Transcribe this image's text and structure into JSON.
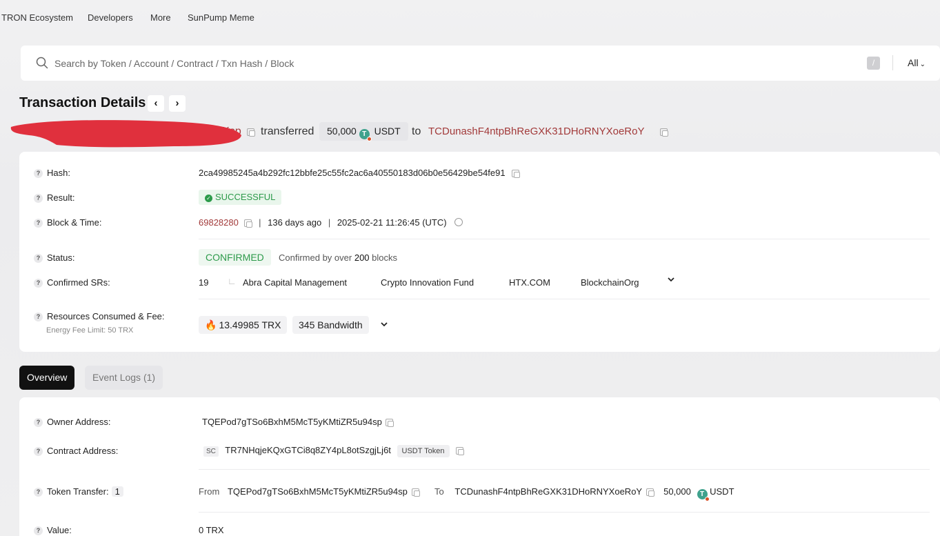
{
  "nav": {
    "items": [
      "TRON Ecosystem",
      "Developers",
      "More",
      "SunPump Meme"
    ]
  },
  "search": {
    "placeholder": "Search by Token / Account / Contract / Txn Hash / Block",
    "shortcut": "/",
    "filter": "All"
  },
  "page": {
    "title": "Transaction Details",
    "prev": "‹",
    "next": "›"
  },
  "summary": {
    "sender_fragment": "...1Ksp",
    "verb": "transferred",
    "amount": "50,000",
    "token": "USDT",
    "to_word": "to",
    "to_address": "TCDunashF4ntpBhReGXK31DHoRNYXoeRoY"
  },
  "details": {
    "hash_label": "Hash:",
    "hash": "2ca49985245a4b292fc12bbfe25c55fc2ac6a40550183d06b0e56429be54fe91",
    "result_label": "Result:",
    "result": "SUCCESSFUL",
    "block_label": "Block & Time:",
    "block": "69828280",
    "age": "136 days ago",
    "time": "2025-02-21 11:26:45 (UTC)",
    "status_label": "Status:",
    "status": "CONFIRMED",
    "confirmed_prefix": "Confirmed by over",
    "confirmed_count": "200",
    "confirmed_suffix": "blocks",
    "srs_label": "Confirmed SRs:",
    "srs_count": "19",
    "srs": [
      "Abra Capital Management",
      "Crypto Innovation Fund",
      "HTX.COM",
      "BlockchainOrg"
    ],
    "resources_label": "Resources Consumed & Fee:",
    "energy_limit": "Energy Fee Limit: 50 TRX",
    "fee_trx": "13.49985 TRX",
    "bandwidth": "345 Bandwidth"
  },
  "tabs": {
    "overview": "Overview",
    "event_logs": "Event Logs (1)"
  },
  "overview": {
    "owner_label": "Owner Address:",
    "owner": "TQEPod7gTSo6BxhM5McT5yKMtiZR5u94sp",
    "contract_label": "Contract Address:",
    "contract_badge": "SC",
    "contract": "TR7NHqjeKQxGTCi8q8ZY4pL8otSzgjLj6t",
    "contract_tag": "USDT Token",
    "transfer_label": "Token Transfer:",
    "transfer_count": "1",
    "from_word": "From",
    "from": "TQEPod7gTSo6BxhM5McT5yKMtiZR5u94sp",
    "to_word": "To",
    "to": "TCDunashF4ntpBhReGXK31DHoRNYXoeRoY",
    "amount": "50,000",
    "token": "USDT",
    "value_label": "Value:",
    "value": "0 TRX"
  },
  "colors": {
    "link_red": "#a23a3a",
    "success_green": "#2c9a4a",
    "redaction": "#e0303d",
    "token_teal": "#3fa28d"
  }
}
